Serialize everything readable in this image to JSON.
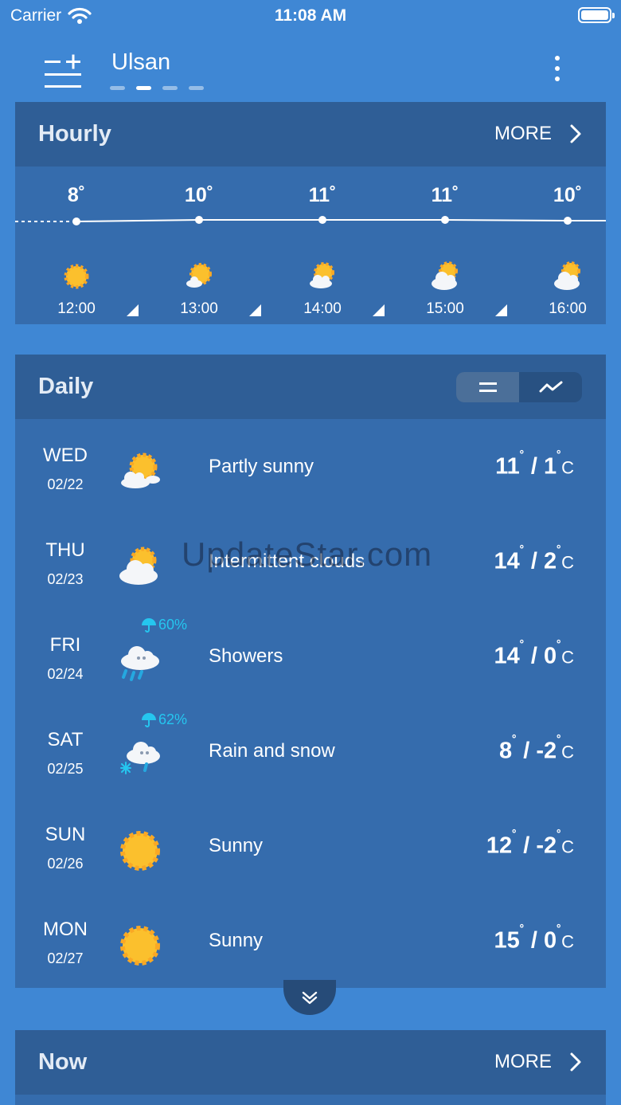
{
  "status_bar": {
    "carrier": "Carrier",
    "time": "11:08 AM"
  },
  "header": {
    "city": "Ulsan",
    "page_count": 4,
    "active_page_index": 1
  },
  "hourly": {
    "title": "Hourly",
    "more_label": "MORE",
    "items": [
      {
        "temp": "8",
        "time": "12:00",
        "icon": "sunny-icon"
      },
      {
        "temp": "10",
        "time": "13:00",
        "icon": "mostly-sunny-icon"
      },
      {
        "temp": "11",
        "time": "14:00",
        "icon": "partly-sunny-icon"
      },
      {
        "temp": "11",
        "time": "15:00",
        "icon": "cloudy-sun-icon"
      },
      {
        "temp": "10",
        "time": "16:00",
        "icon": "cloudy-sun-icon"
      }
    ]
  },
  "daily": {
    "title": "Daily",
    "view_modes": [
      "list-view-icon",
      "graph-view-icon"
    ],
    "selected_view": "list-view-icon",
    "unit": "C",
    "rows": [
      {
        "day": "WED",
        "date": "02/22",
        "icon": "partly-sunny-icon",
        "desc": "Partly sunny",
        "high": "11",
        "low": "1",
        "pop": ""
      },
      {
        "day": "THU",
        "date": "02/23",
        "icon": "intermittent-clouds-icon",
        "desc": "Intermittent clouds",
        "high": "14",
        "low": "2",
        "pop": ""
      },
      {
        "day": "FRI",
        "date": "02/24",
        "icon": "showers-icon",
        "desc": "Showers",
        "high": "14",
        "low": "0",
        "pop": "60%"
      },
      {
        "day": "SAT",
        "date": "02/25",
        "icon": "rain-and-snow-icon",
        "desc": "Rain and snow",
        "high": "8",
        "low": "-2",
        "pop": "62%"
      },
      {
        "day": "SUN",
        "date": "02/26",
        "icon": "sunny-icon",
        "desc": "Sunny",
        "high": "12",
        "low": "-2",
        "pop": ""
      },
      {
        "day": "MON",
        "date": "02/27",
        "icon": "sunny-icon",
        "desc": "Sunny",
        "high": "15",
        "low": "0",
        "pop": ""
      }
    ]
  },
  "now": {
    "title": "Now",
    "more_label": "MORE"
  },
  "watermark": "UpdateStar.com",
  "colors": {
    "background": "#3f87d4",
    "card": "#356cad",
    "card_header": "#2f5e96",
    "precip": "#25c6ef",
    "sun": "#fbc02d"
  }
}
